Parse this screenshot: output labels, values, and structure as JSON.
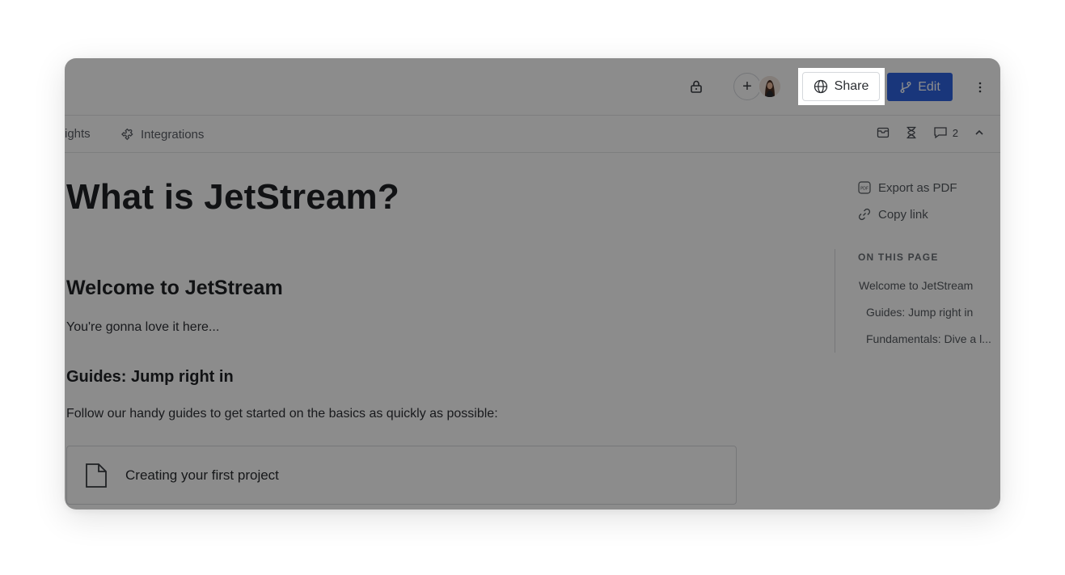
{
  "header": {
    "share_label": "Share",
    "edit_label": "Edit",
    "add_collaborator_symbol": "+"
  },
  "tabs": {
    "insights_label": "ights",
    "integrations_label": "Integrations"
  },
  "toolbar": {
    "comments_count": "2"
  },
  "page": {
    "title": "What is JetStream?",
    "welcome_heading": "Welcome to JetStream",
    "welcome_text": "You're gonna love it here...",
    "guides_heading": "Guides: Jump right in",
    "guides_text": "Follow our handy guides to get started on the basics as quickly as possible:",
    "card_label": "Creating your first project"
  },
  "rail": {
    "export_label": "Export as PDF",
    "copy_label": "Copy link",
    "toc_heading": "ON THIS PAGE",
    "toc_items": [
      "Welcome to JetStream",
      "Guides: Jump right in",
      "Fundamentals: Dive a l..."
    ]
  },
  "colors": {
    "accent": "#2f63e0",
    "overlay": "rgba(0,0,0,0.45)"
  },
  "icons": {
    "lock": "lock-icon",
    "share": "globe-icon",
    "edit": "branch-icon",
    "more": "more-vertical-icon",
    "integrations": "puzzle-icon",
    "archive": "archive-icon",
    "history": "hourglass-icon",
    "comments": "comment-icon",
    "collapse": "chevron-up-icon",
    "pdf": "pdf-icon",
    "link": "link-icon",
    "document": "document-icon"
  }
}
